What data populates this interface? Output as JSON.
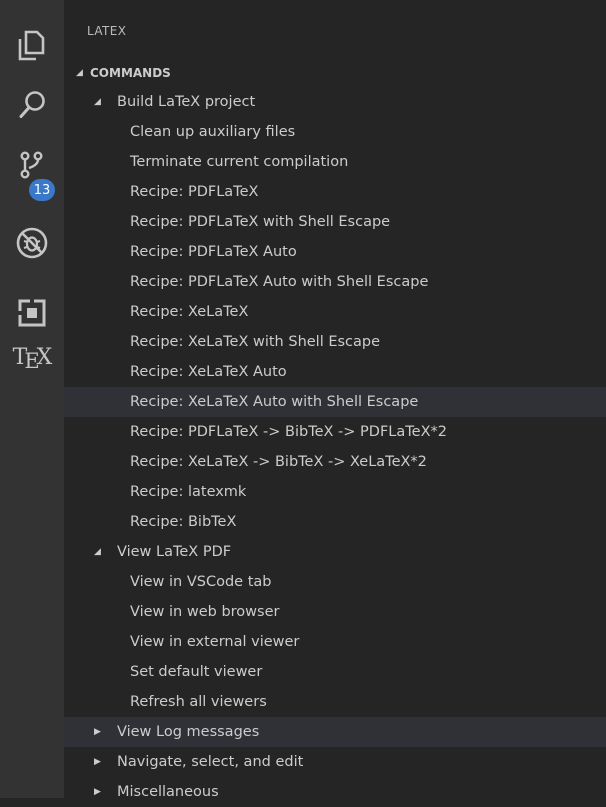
{
  "activity_bar": {
    "items": [
      {
        "name": "explorer-icon"
      },
      {
        "name": "search-icon"
      },
      {
        "name": "source-control-icon",
        "badge": "13"
      },
      {
        "name": "debug-icon"
      },
      {
        "name": "extensions-icon"
      },
      {
        "name": "tex-icon",
        "label_T": "T",
        "label_E": "E",
        "label_X": "X"
      }
    ]
  },
  "sidebar": {
    "title": "LATEX",
    "section": {
      "label": "COMMANDS",
      "expanded": true
    },
    "groups": [
      {
        "label": "Build LaTeX project",
        "expanded": true,
        "items": [
          "Clean up auxiliary files",
          "Terminate current compilation",
          "Recipe: PDFLaTeX",
          "Recipe: PDFLaTeX with Shell Escape",
          "Recipe: PDFLaTeX Auto",
          "Recipe: PDFLaTeX Auto with Shell Escape",
          "Recipe: XeLaTeX",
          "Recipe: XeLaTeX with Shell Escape",
          "Recipe: XeLaTeX Auto",
          "Recipe: XeLaTeX Auto with Shell Escape",
          "Recipe: PDFLaTeX -> BibTeX -> PDFLaTeX*2",
          "Recipe: XeLaTeX -> BibTeX -> XeLaTeX*2",
          "Recipe: latexmk",
          "Recipe: BibTeX"
        ]
      },
      {
        "label": "View LaTeX PDF",
        "expanded": true,
        "items": [
          "View in VSCode tab",
          "View in web browser",
          "View in external viewer",
          "Set default viewer",
          "Refresh all viewers"
        ]
      },
      {
        "label": "View Log messages",
        "expanded": false,
        "items": []
      },
      {
        "label": "Navigate, select, and edit",
        "expanded": false,
        "items": []
      },
      {
        "label": "Miscellaneous",
        "expanded": false,
        "items": []
      }
    ]
  },
  "colors": {
    "activity_bar_bg": "#333333",
    "sidebar_bg": "#252526",
    "hover_bg": "#2f3137",
    "badge_bg": "#3a78c9",
    "text": "#cccccc"
  }
}
